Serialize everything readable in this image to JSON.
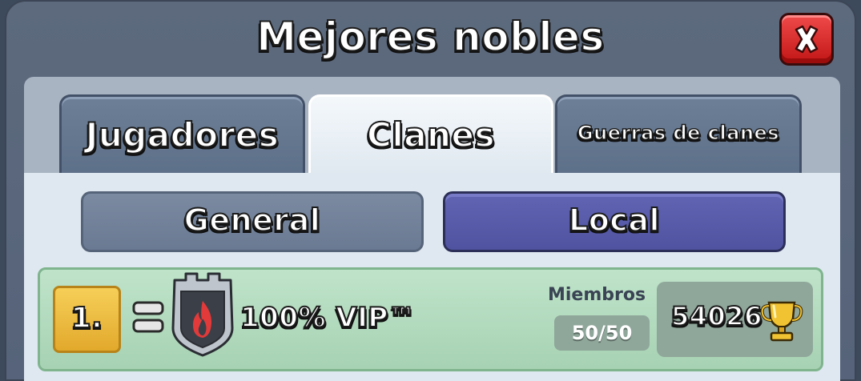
{
  "window": {
    "title": "Mejores nobles",
    "close_icon": "close-x-icon"
  },
  "tabs": [
    {
      "label": "Jugadores",
      "active": false
    },
    {
      "label": "Clanes",
      "active": true
    },
    {
      "label": "Guerras de clanes",
      "active": false
    }
  ],
  "scope": {
    "general_label": "General",
    "local_label": "Local",
    "selected": "Local"
  },
  "leaderboard": {
    "rows": [
      {
        "rank": "1.",
        "change_icon": "no-change-equals-icon",
        "badge_icon": "clan-badge-flame-icon",
        "name": "100% VIP™",
        "members_label": "Miembros",
        "members": "50/50",
        "trophies": "54026",
        "trophy_icon": "trophy-icon"
      }
    ]
  },
  "colors": {
    "close_button": "#d42020",
    "local_tab_selected": "#5559a6",
    "row_background": "#b5dcc0",
    "rank_badge": "#f0c14a"
  }
}
